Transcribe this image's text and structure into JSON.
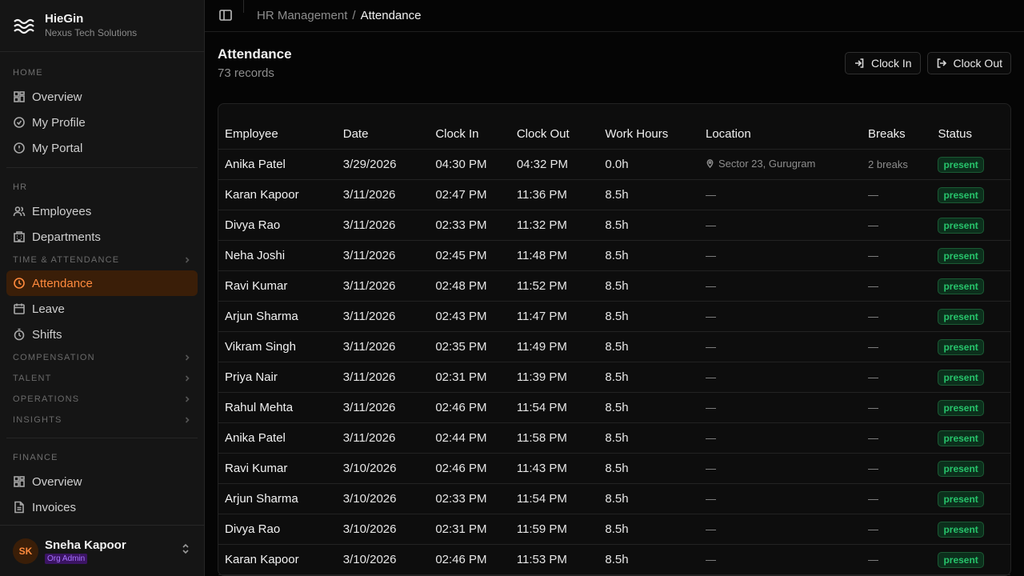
{
  "brand": {
    "name": "HieGin",
    "subtitle": "Nexus Tech Solutions"
  },
  "sidebar": {
    "home": {
      "label": "HOME",
      "items": [
        {
          "label": "Overview",
          "icon": "grid-icon"
        },
        {
          "label": "My Profile",
          "icon": "check-circle-icon"
        },
        {
          "label": "My Portal",
          "icon": "info-circle-icon"
        }
      ]
    },
    "hr": {
      "label": "HR",
      "items": [
        {
          "label": "Employees",
          "icon": "users-icon"
        },
        {
          "label": "Departments",
          "icon": "building-icon"
        }
      ]
    },
    "time_attendance": {
      "label": "TIME & ATTENDANCE",
      "items": [
        {
          "label": "Attendance",
          "icon": "clock-icon",
          "active": true
        },
        {
          "label": "Leave",
          "icon": "calendar-icon"
        },
        {
          "label": "Shifts",
          "icon": "timer-icon"
        }
      ]
    },
    "groups": [
      "COMPENSATION",
      "TALENT",
      "OPERATIONS",
      "INSIGHTS"
    ],
    "finance": {
      "label": "FINANCE",
      "items": [
        {
          "label": "Overview",
          "icon": "grid-icon"
        },
        {
          "label": "Invoices",
          "icon": "file-icon"
        }
      ]
    },
    "user": {
      "initials": "SK",
      "name": "Sneha Kapoor",
      "role": "Org Admin"
    }
  },
  "breadcrumb": {
    "parent": "HR Management",
    "separator": "/",
    "current": "Attendance"
  },
  "page": {
    "title": "Attendance",
    "subtitle": "73 records"
  },
  "actions": {
    "clock_in": "Clock In",
    "clock_out": "Clock Out"
  },
  "table": {
    "columns": [
      "Employee",
      "Date",
      "Clock In",
      "Clock Out",
      "Work Hours",
      "Location",
      "Breaks",
      "Status"
    ],
    "rows": [
      [
        "Anika Patel",
        "3/29/2026",
        "04:30 PM",
        "04:32 PM",
        "0.0h",
        "Sector 23, Gurugram",
        "2 breaks",
        "present"
      ],
      [
        "Karan Kapoor",
        "3/11/2026",
        "02:47 PM",
        "11:36 PM",
        "8.5h",
        "—",
        "—",
        "present"
      ],
      [
        "Divya Rao",
        "3/11/2026",
        "02:33 PM",
        "11:32 PM",
        "8.5h",
        "—",
        "—",
        "present"
      ],
      [
        "Neha Joshi",
        "3/11/2026",
        "02:45 PM",
        "11:48 PM",
        "8.5h",
        "—",
        "—",
        "present"
      ],
      [
        "Ravi Kumar",
        "3/11/2026",
        "02:48 PM",
        "11:52 PM",
        "8.5h",
        "—",
        "—",
        "present"
      ],
      [
        "Arjun Sharma",
        "3/11/2026",
        "02:43 PM",
        "11:47 PM",
        "8.5h",
        "—",
        "—",
        "present"
      ],
      [
        "Vikram Singh",
        "3/11/2026",
        "02:35 PM",
        "11:49 PM",
        "8.5h",
        "—",
        "—",
        "present"
      ],
      [
        "Priya Nair",
        "3/11/2026",
        "02:31 PM",
        "11:39 PM",
        "8.5h",
        "—",
        "—",
        "present"
      ],
      [
        "Rahul Mehta",
        "3/11/2026",
        "02:46 PM",
        "11:54 PM",
        "8.5h",
        "—",
        "—",
        "present"
      ],
      [
        "Anika Patel",
        "3/11/2026",
        "02:44 PM",
        "11:58 PM",
        "8.5h",
        "—",
        "—",
        "present"
      ],
      [
        "Ravi Kumar",
        "3/10/2026",
        "02:46 PM",
        "11:43 PM",
        "8.5h",
        "—",
        "—",
        "present"
      ],
      [
        "Arjun Sharma",
        "3/10/2026",
        "02:33 PM",
        "11:54 PM",
        "8.5h",
        "—",
        "—",
        "present"
      ],
      [
        "Divya Rao",
        "3/10/2026",
        "02:31 PM",
        "11:59 PM",
        "8.5h",
        "—",
        "—",
        "present"
      ],
      [
        "Karan Kapoor",
        "3/10/2026",
        "02:46 PM",
        "11:53 PM",
        "8.5h",
        "—",
        "—",
        "present"
      ]
    ]
  },
  "colors": {
    "accent": "#ff8a3d",
    "accent_bg": "#3a1e08",
    "status_green": "#27c46b",
    "role_purple": "#a873ff"
  }
}
